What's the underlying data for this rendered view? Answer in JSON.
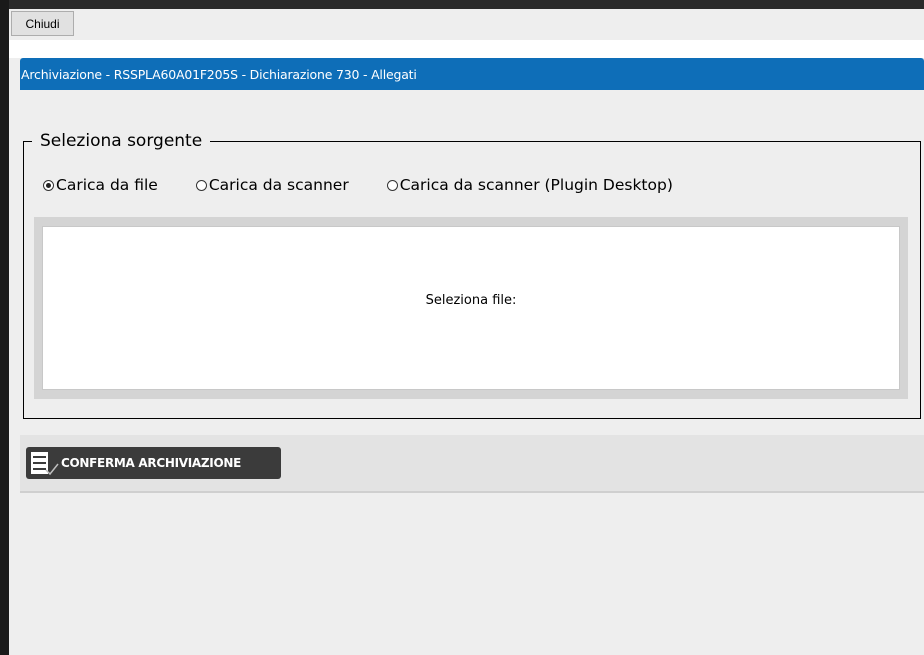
{
  "toolbar": {
    "close_label": "Chiudi"
  },
  "window": {
    "title": "Archiviazione - RSSPLA60A01F205S - Dichiarazione 730 - Allegati",
    "title_bar_color": "#0e6eb8"
  },
  "source_panel": {
    "legend": "Seleziona sorgente",
    "options": [
      {
        "label": "Carica da file",
        "checked": true
      },
      {
        "label": "Carica da scanner",
        "checked": false
      },
      {
        "label": "Carica da scanner (Plugin Desktop)",
        "checked": false
      }
    ],
    "file_label": "Seleziona file:"
  },
  "actions": {
    "confirm_label": "CONFERMA ARCHIVIAZIONE",
    "confirm_icon": "archive-check-icon"
  }
}
